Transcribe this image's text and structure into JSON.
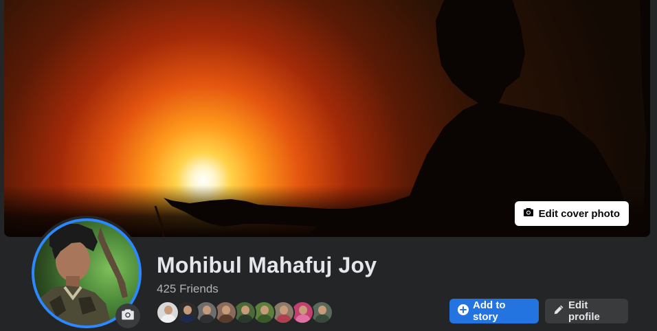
{
  "profile": {
    "name": "Mohibul Mahafuj Joy",
    "friends_count_label": "425 Friends"
  },
  "cover": {
    "edit_cover_label": "Edit cover photo"
  },
  "actions": {
    "add_to_story_label": "Add to story",
    "edit_profile_label": "Edit profile"
  },
  "friend_previews": [
    {
      "bg": "#d9d9d9",
      "shirt": "#f0f0f0"
    },
    {
      "bg": "#2b2b2b",
      "shirt": "#1d2a4a"
    },
    {
      "bg": "#6d6d6d",
      "shirt": "#303030"
    },
    {
      "bg": "#8a6a5a",
      "shirt": "#5a3a2a"
    },
    {
      "bg": "#4a6a3a",
      "shirt": "#2a3a2a"
    },
    {
      "bg": "#5c7f3c",
      "shirt": "#3a5a2a"
    },
    {
      "bg": "#8a7a6a",
      "shirt": "#b04050"
    },
    {
      "bg": "#c04070",
      "shirt": "#e070a0"
    },
    {
      "bg": "#5a6a5a",
      "shirt": "#3a4a3a"
    }
  ],
  "colors": {
    "accent": "#2374e1",
    "avatar_ring": "#2d88ff",
    "background": "#242526",
    "text_primary": "#e4e6eb",
    "text_secondary": "#b0b3b8"
  },
  "icons": {
    "cover_camera": "camera-icon",
    "avatar_camera": "camera-icon",
    "story_plus": "plus-circle-icon",
    "edit_pencil": "pencil-icon"
  }
}
